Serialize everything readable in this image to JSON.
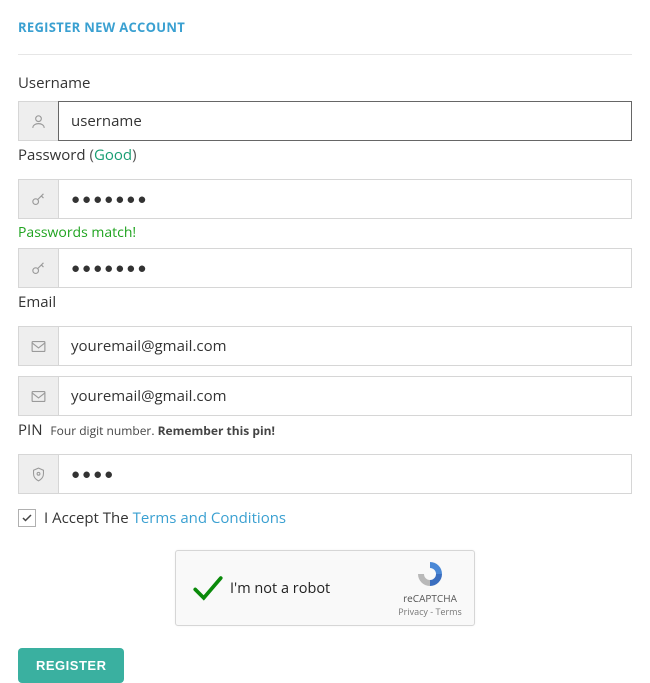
{
  "heading": "REGISTER NEW ACCOUNT",
  "username": {
    "label": "Username",
    "value": "username"
  },
  "password": {
    "label": "Password",
    "strength_prefix": "(",
    "strength_text": "Good",
    "strength_suffix": ")",
    "match_text": "Passwords match!",
    "mask1": "●●●●●●●",
    "mask2": "●●●●●●●"
  },
  "email": {
    "label": "Email",
    "value1": "youremail@gmail.com",
    "value2": "youremail@gmail.com"
  },
  "pin": {
    "label": "PIN",
    "hint_plain": "Four digit number.",
    "hint_strong": "Remember this pin!",
    "mask": "●●●●"
  },
  "terms": {
    "prefix": "I Accept The ",
    "link": "Terms and Conditions",
    "checked": true
  },
  "captcha": {
    "label": "I'm not a robot",
    "brand": "reCAPTCHA",
    "privacy": "Privacy",
    "dash": " - ",
    "terms": "Terms"
  },
  "register_label": "REGISTER"
}
